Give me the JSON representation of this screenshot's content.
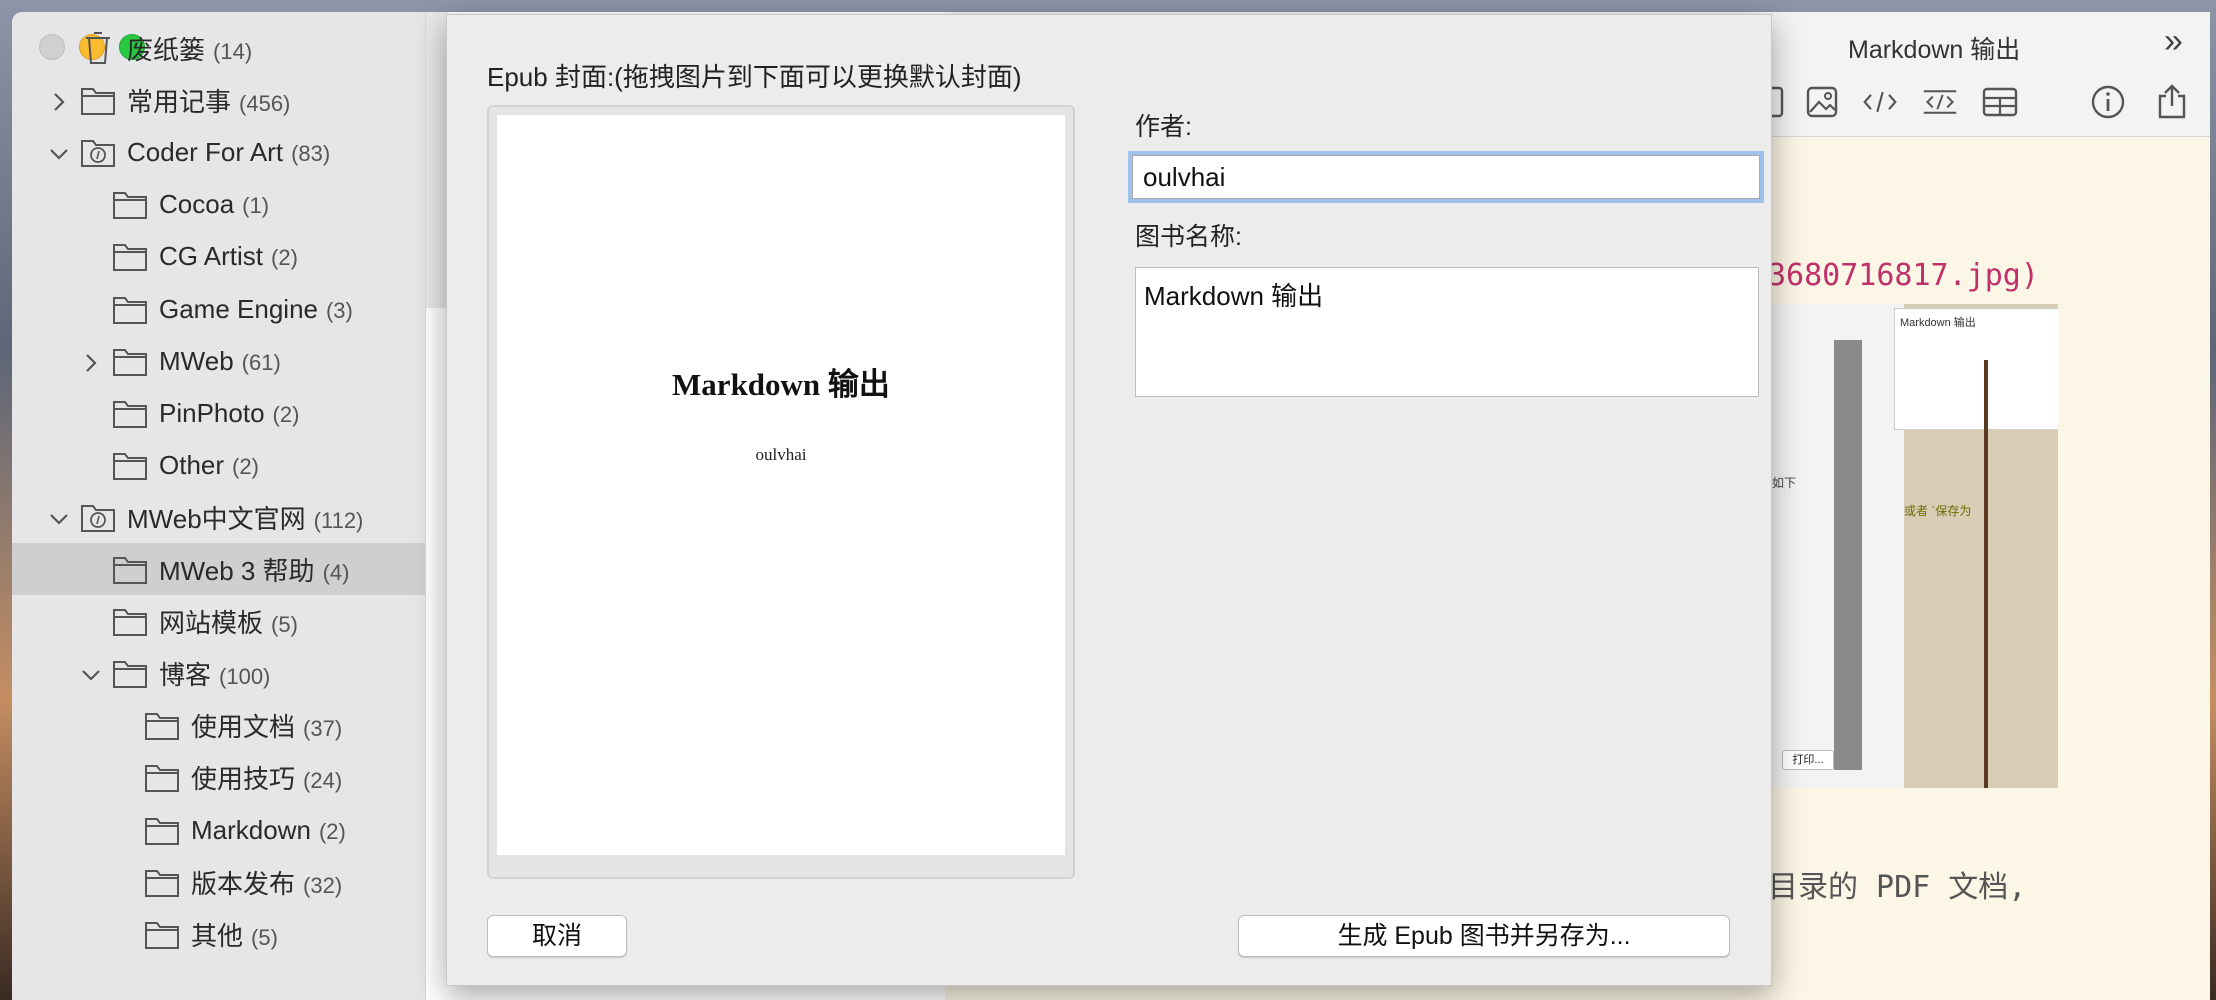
{
  "sidebar": {
    "items": [
      {
        "label": "废纸篓",
        "count": "(14)",
        "icon": "trash-icon",
        "chevron": "none",
        "level": 0
      },
      {
        "label": "常用记事",
        "count": "(456)",
        "icon": "folder-icon",
        "chevron": "right",
        "level": 0
      },
      {
        "label": "Coder For Art",
        "count": "(83)",
        "icon": "smart-folder-icon",
        "chevron": "down",
        "level": 0
      },
      {
        "label": "Cocoa",
        "count": "(1)",
        "icon": "folder-icon",
        "chevron": "none",
        "level": 1
      },
      {
        "label": "CG Artist",
        "count": "(2)",
        "icon": "folder-icon",
        "chevron": "none",
        "level": 1
      },
      {
        "label": "Game Engine",
        "count": "(3)",
        "icon": "folder-icon",
        "chevron": "none",
        "level": 1
      },
      {
        "label": "MWeb",
        "count": "(61)",
        "icon": "folder-icon",
        "chevron": "right",
        "level": 1
      },
      {
        "label": "PinPhoto",
        "count": "(2)",
        "icon": "folder-icon",
        "chevron": "none",
        "level": 1
      },
      {
        "label": "Other",
        "count": "(2)",
        "icon": "folder-icon",
        "chevron": "none",
        "level": 1
      },
      {
        "label": "MWeb中文官网",
        "count": "(112)",
        "icon": "smart-folder-icon",
        "chevron": "down",
        "level": 0
      },
      {
        "label": "MWeb 3 帮助",
        "count": "(4)",
        "icon": "folder-icon",
        "chevron": "none",
        "level": 1,
        "selected": true
      },
      {
        "label": "网站模板",
        "count": "(5)",
        "icon": "folder-icon",
        "chevron": "none",
        "level": 1
      },
      {
        "label": "博客",
        "count": "(100)",
        "icon": "folder-icon",
        "chevron": "down",
        "level": 1
      },
      {
        "label": "使用文档",
        "count": "(37)",
        "icon": "folder-icon",
        "chevron": "none",
        "level": 2
      },
      {
        "label": "使用技巧",
        "count": "(24)",
        "icon": "folder-icon",
        "chevron": "none",
        "level": 2
      },
      {
        "label": "Markdown",
        "count": "(2)",
        "icon": "folder-icon",
        "chevron": "none",
        "level": 2
      },
      {
        "label": "版本发布",
        "count": "(32)",
        "icon": "folder-icon",
        "chevron": "none",
        "level": 2
      },
      {
        "label": "其他",
        "count": "(5)",
        "icon": "folder-icon",
        "chevron": "none",
        "level": 2
      }
    ]
  },
  "window": {
    "title": "Markdown 输出",
    "more_glyph": "»",
    "toolbar_icons": [
      "image-icon",
      "image-icon",
      "code-icon",
      "code-block-icon",
      "table-icon",
      "info-icon",
      "share-icon"
    ]
  },
  "editor": {
    "code_fragment": "3680716817.jpg)",
    "text_fragment": "目录的 PDF 文档,",
    "thumbnail": {
      "title": "Markdown 输出",
      "note1": "如下",
      "note2": "或者 `保存为",
      "print_button": "打印..."
    }
  },
  "dialog": {
    "heading": "Epub 封面:(拖拽图片到下面可以更换默认封面)",
    "cover": {
      "title": "Markdown 输出",
      "author": "oulvhai"
    },
    "author_label": "作者:",
    "author_value": "oulvhai",
    "book_title_label": "图书名称:",
    "book_title_value": "Markdown 输出",
    "cancel_button": "取消",
    "generate_button": "生成 Epub 图书并另存为..."
  },
  "colors": {
    "accent_focus": "#9fc1ec",
    "close_button": "#d0d0d2",
    "minimize_button": "#fdbc2e",
    "zoom_button": "#28c840",
    "code_text": "#c0306a",
    "editor_bg": "#fcf6e6"
  }
}
